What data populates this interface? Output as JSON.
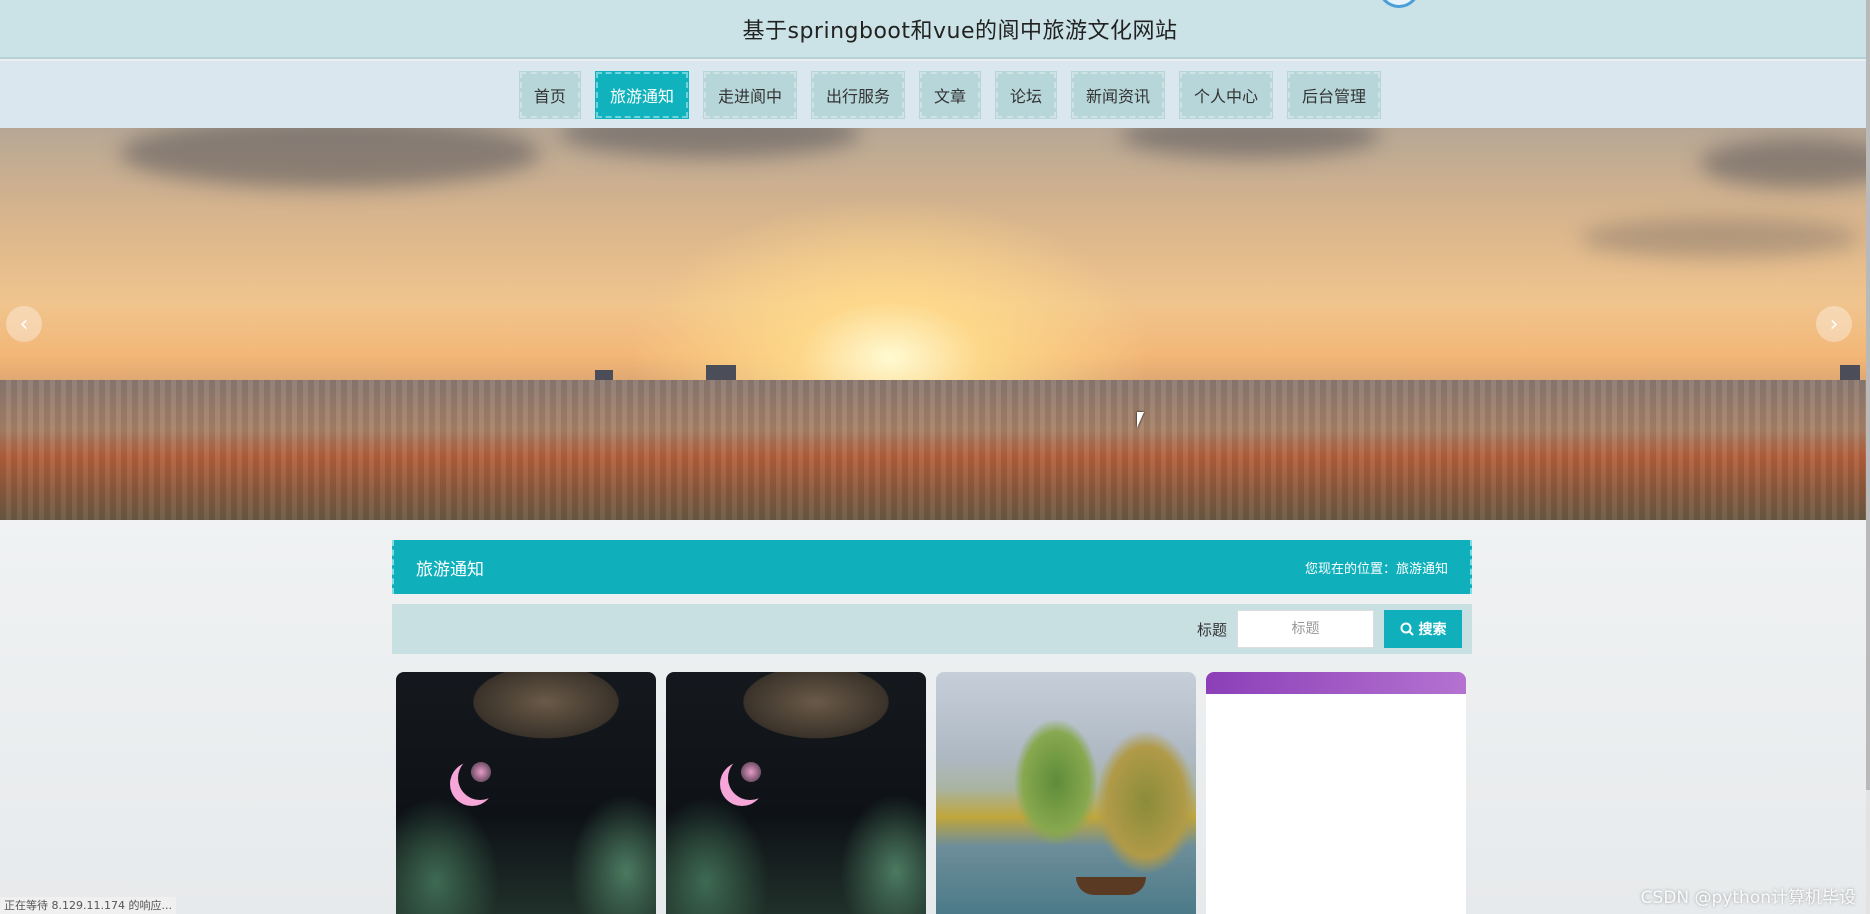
{
  "header": {
    "title": "基于springboot和vue的阆中旅游文化网站"
  },
  "nav": {
    "items": [
      {
        "label": "首页",
        "active": false
      },
      {
        "label": "旅游通知",
        "active": true
      },
      {
        "label": "走进阆中",
        "active": false
      },
      {
        "label": "出行服务",
        "active": false
      },
      {
        "label": "文章",
        "active": false
      },
      {
        "label": "论坛",
        "active": false
      },
      {
        "label": "新闻资讯",
        "active": false
      },
      {
        "label": "个人中心",
        "active": false
      },
      {
        "label": "后台管理",
        "active": false
      }
    ]
  },
  "banner": {
    "prev_icon": "chevron-left-icon",
    "next_icon": "chevron-right-icon"
  },
  "section": {
    "title": "旅游通知",
    "breadcrumb": "您现在的位置：旅游通知"
  },
  "search": {
    "label": "标题",
    "placeholder": "标题",
    "button_label": "搜索",
    "button_icon": "search-icon"
  },
  "status_bar": {
    "text": "正在等待 8.129.11.174 的响应..."
  },
  "watermark": {
    "text": "CSDN @python计算机毕设"
  },
  "colors": {
    "accent": "#0fb0bc",
    "nav_bg": "#b7d6d9",
    "header_bg": "#cbe3e6"
  }
}
